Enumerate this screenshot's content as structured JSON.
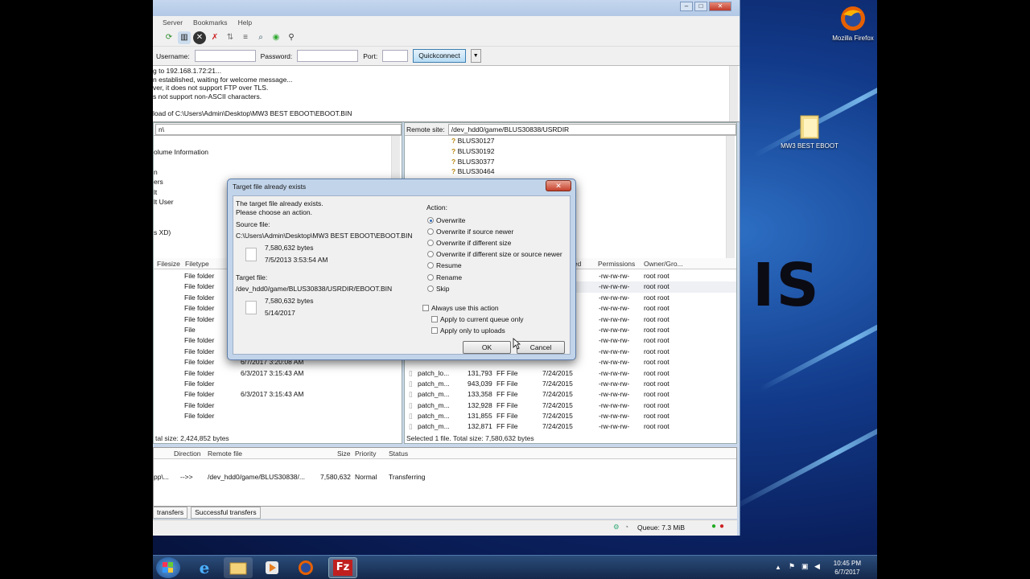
{
  "desktop": {
    "background_text": "IS",
    "icons": [
      {
        "label": "Mozilla Firefox",
        "icon": "firefox-icon"
      },
      {
        "label": "MW3 BEST EBOOT",
        "icon": "folder-icon"
      }
    ]
  },
  "window": {
    "menu": [
      "Server",
      "Bookmarks",
      "Help"
    ],
    "quickconnect": {
      "username_label": "Username:",
      "password_label": "Password:",
      "port_label": "Port:",
      "button": "Quickconnect",
      "dropdown": "▼"
    },
    "log": [
      "g to 192.168.1.72:21...",
      "n established, waiting for welcome message...",
      "ver, it does not support FTP over TLS.",
      "s not support non-ASCII characters.",
      "",
      "load of C:\\Users\\Admin\\Desktop\\MW3 BEST EBOOT\\EBOOT.BIN"
    ],
    "local": {
      "path": "n\\",
      "tree": [
        "olume Information",
        "n",
        "ers",
        "lt",
        "lt User",
        "",
        "",
        "s XD)"
      ],
      "columns": [
        "Filesize",
        "Filetype"
      ],
      "rows": [
        {
          "type": "File folder",
          "date": ""
        },
        {
          "type": "File folder",
          "date": ""
        },
        {
          "type": "File folder",
          "date": ""
        },
        {
          "type": "File folder",
          "date": ""
        },
        {
          "type": "File folder",
          "date": ""
        },
        {
          "type": "File",
          "date": ""
        },
        {
          "type": "File folder",
          "date": ""
        },
        {
          "type": "File folder",
          "date": ""
        },
        {
          "type": "File folder",
          "date": "6/7/2017 3:20:08 AM"
        },
        {
          "type": "File folder",
          "date": "6/3/2017 3:15:43 AM"
        },
        {
          "type": "File folder",
          "date": ""
        },
        {
          "type": "File folder",
          "date": "6/3/2017 3:15:43 AM"
        },
        {
          "type": "File folder",
          "date": ""
        },
        {
          "type": "File folder",
          "date": ""
        }
      ],
      "status": "tal size: 2,424,852 bytes"
    },
    "remote": {
      "site_label": "Remote site:",
      "path": "/dev_hdd0/game/BLUS30838/USRDIR",
      "tree": [
        "BLUS30127",
        "BLUS30192",
        "BLUS30377",
        "BLUS30464"
      ],
      "columns": [
        "ied",
        "Permissions",
        "Owner/Gro..."
      ],
      "rows": [
        {
          "name": "",
          "size": "",
          "type": "",
          "date": "",
          "perm": "-rw-rw-rw-",
          "owner": "root root"
        },
        {
          "name": "",
          "size": "",
          "type": "",
          "date": "",
          "perm": "-rw-rw-rw-",
          "owner": "root root"
        },
        {
          "name": "",
          "size": "",
          "type": "",
          "date": "",
          "perm": "-rw-rw-rw-",
          "owner": "root root"
        },
        {
          "name": "",
          "size": "",
          "type": "",
          "date": "",
          "perm": "-rw-rw-rw-",
          "owner": "root root"
        },
        {
          "name": "",
          "size": "",
          "type": "",
          "date": "",
          "perm": "-rw-rw-rw-",
          "owner": "root root"
        },
        {
          "name": "",
          "size": "",
          "type": "",
          "date": "",
          "perm": "-rw-rw-rw-",
          "owner": "root root"
        },
        {
          "name": "",
          "size": "",
          "type": "",
          "date": "",
          "perm": "-rw-rw-rw-",
          "owner": "root root"
        },
        {
          "name": "",
          "size": "",
          "type": "",
          "date": "",
          "perm": "-rw-rw-rw-",
          "owner": "root root"
        },
        {
          "name": "",
          "size": "",
          "type": "",
          "date": "",
          "perm": "-rw-rw-rw-",
          "owner": "root root"
        },
        {
          "name": "patch_lo...",
          "size": "131,793",
          "type": "FF File",
          "date": "7/24/2015",
          "perm": "-rw-rw-rw-",
          "owner": "root root"
        },
        {
          "name": "patch_m...",
          "size": "943,039",
          "type": "FF File",
          "date": "7/24/2015",
          "perm": "-rw-rw-rw-",
          "owner": "root root"
        },
        {
          "name": "patch_m...",
          "size": "133,358",
          "type": "FF File",
          "date": "7/24/2015",
          "perm": "-rw-rw-rw-",
          "owner": "root root"
        },
        {
          "name": "patch_m...",
          "size": "132,928",
          "type": "FF File",
          "date": "7/24/2015",
          "perm": "-rw-rw-rw-",
          "owner": "root root"
        },
        {
          "name": "patch_m...",
          "size": "131,855",
          "type": "FF File",
          "date": "7/24/2015",
          "perm": "-rw-rw-rw-",
          "owner": "root root"
        },
        {
          "name": "patch_m...",
          "size": "132,871",
          "type": "FF File",
          "date": "7/24/2015",
          "perm": "-rw-rw-rw-",
          "owner": "root root"
        }
      ],
      "status": "Selected 1 file. Total size: 7,580,632 bytes"
    },
    "queue": {
      "columns": [
        "Direction",
        "Remote file",
        "Size",
        "Priority",
        "Status"
      ],
      "row": {
        "local": "pp\\...",
        "direction": "-->>",
        "remote": "/dev_hdd0/game/BLUS30838/...",
        "size": "7,580,632",
        "priority": "Normal",
        "status": "Transferring"
      },
      "tabs": [
        "transfers",
        "Successful transfers"
      ],
      "queue_status": "Queue: 7.3 MiB"
    }
  },
  "dialog": {
    "title": "Target file already exists",
    "close": "✕",
    "intro1": "The target file already exists.",
    "intro2": "Please choose an action.",
    "source_label": "Source file:",
    "source_path": "C:\\Users\\Admin\\Desktop\\MW3 BEST EBOOT\\EBOOT.BIN",
    "source_size": "7,580,632 bytes",
    "source_date": "7/5/2013 3:53:54 AM",
    "target_label": "Target file:",
    "target_path": "/dev_hdd0/game/BLUS30838/USRDIR/EBOOT.BIN",
    "target_size": "7,580,632 bytes",
    "target_date": "5/14/2017",
    "action_label": "Action:",
    "actions": [
      "Overwrite",
      "Overwrite if source newer",
      "Overwrite if different size",
      "Overwrite if different size or source newer",
      "Resume",
      "Rename",
      "Skip"
    ],
    "selected_action": "Overwrite",
    "always_label": "Always use this action",
    "apply_queue": "Apply to current queue only",
    "apply_uploads": "Apply only to uploads",
    "ok": "OK",
    "cancel": "Cancel"
  },
  "taskbar": {
    "time": "10:45 PM",
    "date": "6/7/2017"
  }
}
